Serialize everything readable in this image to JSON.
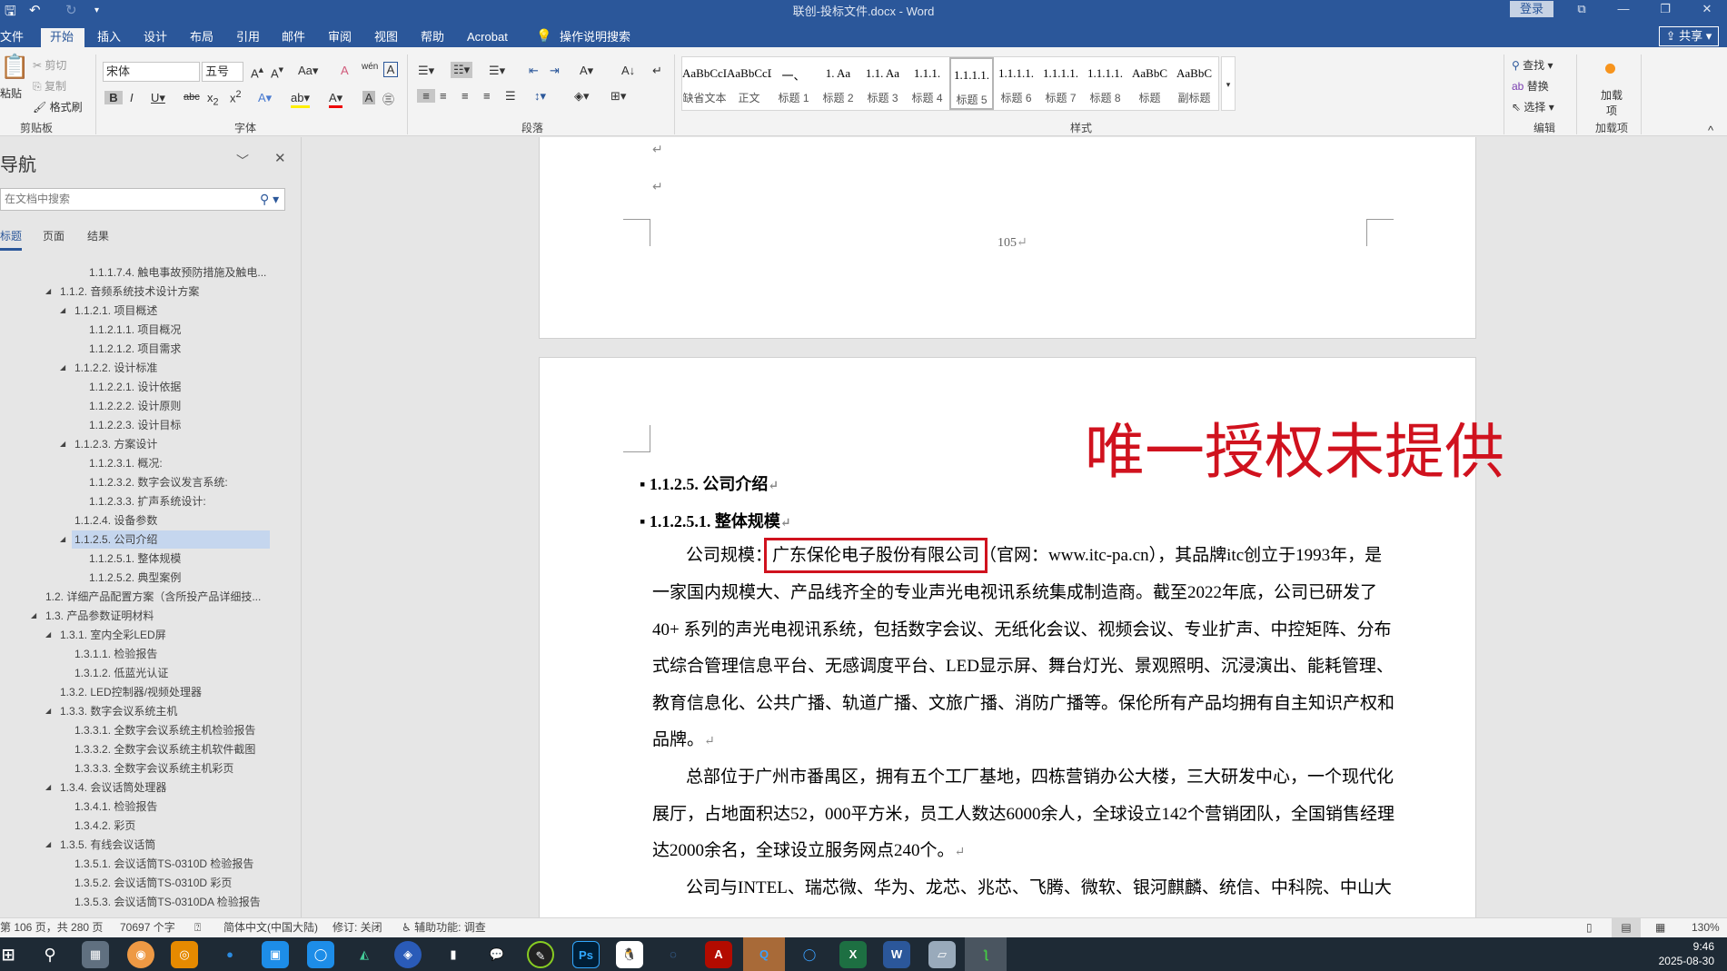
{
  "window": {
    "title": "联创-投标文件.docx  -  Word",
    "login": "登录",
    "share": "共享"
  },
  "tabs": [
    "文件",
    "开始",
    "插入",
    "设计",
    "布局",
    "引用",
    "邮件",
    "审阅",
    "视图",
    "帮助",
    "Acrobat"
  ],
  "tell_me": "操作说明搜索",
  "ribbon": {
    "clipboard": {
      "paste": "粘贴",
      "cut": "剪切",
      "copy": "复制",
      "format_painter": "格式刷",
      "label": "剪贴板"
    },
    "font": {
      "name": "宋体",
      "size": "五号",
      "label": "字体"
    },
    "paragraph": {
      "label": "段落"
    },
    "styles": {
      "label": "样式",
      "items": [
        {
          "sample": "AaBbCcI",
          "name": "缺省文本"
        },
        {
          "sample": "AaBbCcDdI",
          "name": "正文"
        },
        {
          "sample": "一、",
          "name": "标题 1"
        },
        {
          "sample": "1.  Aa",
          "name": "标题 2"
        },
        {
          "sample": "1.1.  Aa",
          "name": "标题 3"
        },
        {
          "sample": "1.1.1.",
          "name": "标题 4"
        },
        {
          "sample": "1.1.1.1.",
          "name": "标题 5"
        },
        {
          "sample": "1.1.1.1.",
          "name": "标题 6"
        },
        {
          "sample": "1.1.1.1.",
          "name": "标题 7"
        },
        {
          "sample": "1.1.1.1.",
          "name": "标题 8"
        },
        {
          "sample": "AaBbC",
          "name": "标题"
        },
        {
          "sample": "AaBbC",
          "name": "副标题"
        }
      ]
    },
    "editing": {
      "find": "查找",
      "replace": "替换",
      "select": "选择",
      "label": "编辑"
    },
    "addins": {
      "button": "加载项",
      "label": "加载项"
    }
  },
  "nav": {
    "title": "导航",
    "search_placeholder": "在文档中搜索",
    "tabs": [
      "标题",
      "页面",
      "结果"
    ],
    "items": [
      {
        "level": 4,
        "text": "1.1.1.7.4. 触电事故预防措施及触电...",
        "exp": false
      },
      {
        "level": 2,
        "text": "1.1.2. 音频系统技术设计方案",
        "exp": true
      },
      {
        "level": 3,
        "text": "1.1.2.1. 项目概述",
        "exp": true
      },
      {
        "level": 4,
        "text": "1.1.2.1.1. 项目概况",
        "exp": false
      },
      {
        "level": 4,
        "text": "1.1.2.1.2. 项目需求",
        "exp": false
      },
      {
        "level": 3,
        "text": "1.1.2.2. 设计标准",
        "exp": true
      },
      {
        "level": 4,
        "text": "1.1.2.2.1. 设计依据",
        "exp": false
      },
      {
        "level": 4,
        "text": "1.1.2.2.2. 设计原则",
        "exp": false
      },
      {
        "level": 4,
        "text": "1.1.2.2.3. 设计目标",
        "exp": false
      },
      {
        "level": 3,
        "text": "1.1.2.3. 方案设计",
        "exp": true
      },
      {
        "level": 4,
        "text": "1.1.2.3.1. 概况:",
        "exp": false
      },
      {
        "level": 4,
        "text": "1.1.2.3.2. 数字会议发言系统:",
        "exp": false
      },
      {
        "level": 4,
        "text": "1.1.2.3.3. 扩声系统设计:",
        "exp": false
      },
      {
        "level": 3,
        "text": "1.1.2.4. 设备参数",
        "exp": false
      },
      {
        "level": 3,
        "text": "1.1.2.5. 公司介绍",
        "exp": true,
        "selected": true
      },
      {
        "level": 4,
        "text": "1.1.2.5.1. 整体规模",
        "exp": false
      },
      {
        "level": 4,
        "text": "1.1.2.5.2. 典型案例",
        "exp": false
      },
      {
        "level": 1,
        "text": "1.2. 详细产品配置方案（含所投产品详细技...",
        "exp": false
      },
      {
        "level": 1,
        "text": "1.3. 产品参数证明材料",
        "exp": true
      },
      {
        "level": 2,
        "text": "1.3.1. 室内全彩LED屏",
        "exp": true
      },
      {
        "level": 3,
        "text": "1.3.1.1. 检验报告",
        "exp": false
      },
      {
        "level": 3,
        "text": "1.3.1.2. 低蓝光认证",
        "exp": false
      },
      {
        "level": 2,
        "text": "1.3.2. LED控制器/视频处理器",
        "exp": false
      },
      {
        "level": 2,
        "text": "1.3.3. 数字会议系统主机",
        "exp": true
      },
      {
        "level": 3,
        "text": "1.3.3.1. 全数字会议系统主机检验报告",
        "exp": false
      },
      {
        "level": 3,
        "text": "1.3.3.2. 全数字会议系统主机软件截图",
        "exp": false
      },
      {
        "level": 3,
        "text": "1.3.3.3. 全数字会议系统主机彩页",
        "exp": false
      },
      {
        "level": 2,
        "text": "1.3.4. 会议话筒处理器",
        "exp": true
      },
      {
        "level": 3,
        "text": "1.3.4.1. 检验报告",
        "exp": false
      },
      {
        "level": 3,
        "text": "1.3.4.2. 彩页",
        "exp": false
      },
      {
        "level": 2,
        "text": "1.3.5. 有线会议话筒",
        "exp": true
      },
      {
        "level": 3,
        "text": "1.3.5.1. 会议话筒TS-0310D 检验报告",
        "exp": false
      },
      {
        "level": 3,
        "text": "1.3.5.2. 会议话筒TS-0310D 彩页",
        "exp": false
      },
      {
        "level": 3,
        "text": "1.3.5.3. 会议话筒TS-0310DA 检验报告",
        "exp": false
      }
    ]
  },
  "document": {
    "page_number": "105",
    "stamp": "唯一授权未提供",
    "heading1": "1.1.2.5. 公司介绍",
    "heading2": "1.1.2.5.1. 整体规模",
    "p1_prefix": "公司规模：",
    "p1_company": "广东保伦电子股份有限公司",
    "p1_rest": "（官网：www.itc-pa.cn），其品牌itc创立于1993年，是",
    "p1_lines": [
      "一家国内规模大、产品线齐全的专业声光电视讯系统集成制造商。截至2022年底，公司已研发了",
      "40+ 系列的声光电视讯系统，包括数字会议、无纸化会议、视频会议、专业扩声、中控矩阵、分布",
      "式综合管理信息平台、无感调度平台、LED显示屏、舞台灯光、景观照明、沉浸演出、能耗管理、",
      "教育信息化、公共广播、轨道广播、文旅广播、消防广播等。保伦所有产品均拥有自主知识产权和",
      "品牌。"
    ],
    "p2_lines": [
      "总部位于广州市番禺区，拥有五个工厂基地，四栋营销办公大楼，三大研发中心，一个现代化",
      "展厅，占地面积达52，000平方米，员工人数达6000余人，全球设立142个营销团队，全国销售经理",
      "达2000余名，全球设立服务网点240个。"
    ],
    "p3_lines": [
      "公司与INTEL、瑞芯微、华为、龙芯、兆芯、飞腾、微软、银河麒麟、统信、中科院、中山大"
    ]
  },
  "status": {
    "page": "第 106 页，共 280 页",
    "words": "70697 个字",
    "language": "简体中文(中国大陆)",
    "track": "修订: 关闭",
    "accessibility": "辅助功能: 调查",
    "zoom": "130%"
  },
  "taskbar": {
    "time": "9:46",
    "date": "2025-08-30"
  },
  "colors": {
    "brand": "#2b579a",
    "stamp": "#d0121e",
    "selection": "#c5d6ee"
  }
}
